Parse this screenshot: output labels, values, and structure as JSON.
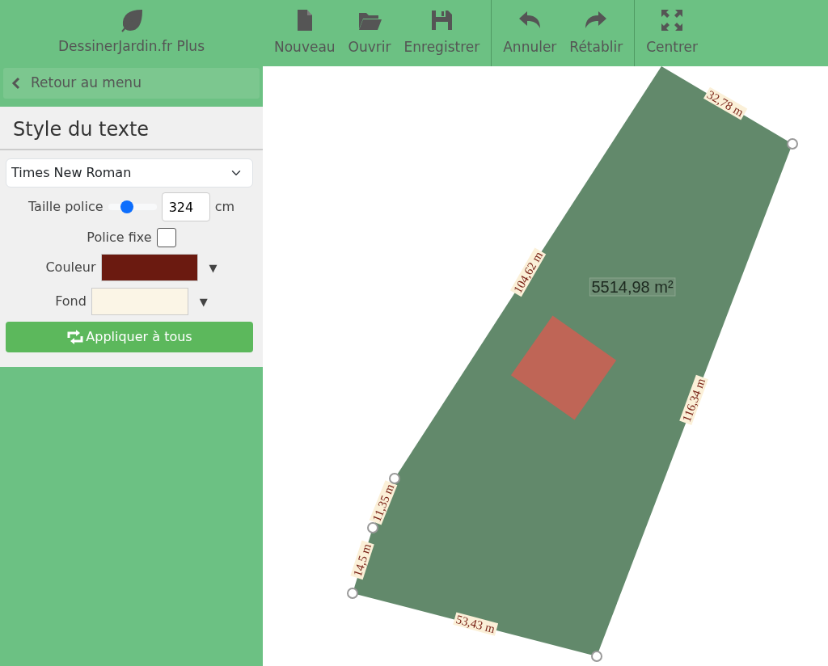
{
  "app": {
    "title": "DessinerJardin.fr Plus"
  },
  "toolbar": {
    "groups": [
      {
        "buttons": [
          {
            "label": "Nouveau",
            "kind": "file"
          },
          {
            "label": "Ouvrir",
            "kind": "folder"
          },
          {
            "label": "Enregistrer",
            "kind": "save"
          }
        ]
      },
      {
        "buttons": [
          {
            "label": "Annuler",
            "kind": "undo"
          },
          {
            "label": "Rétablir",
            "kind": "redo"
          }
        ]
      },
      {
        "buttons": [
          {
            "label": "Centrer",
            "kind": "center"
          }
        ]
      }
    ]
  },
  "sidebar": {
    "back_button": "Retour au menu",
    "panel_title": "Style du texte",
    "font": "Times New Roman",
    "font_size": {
      "label": "Taille police",
      "level": 0.35,
      "value": "324",
      "unit": "cm"
    },
    "fixed_font": {
      "label": "Police fixe",
      "checked": false
    },
    "colors": [
      {
        "label": "Couleur",
        "color": "#6b1a10",
        "arrow": "▼"
      },
      {
        "label": "Fond",
        "color": "#fbf5e6",
        "arrow": "▼"
      }
    ],
    "apply_button": "Appliquer à tous"
  },
  "canvas": {
    "area_label": "5514,98 m²",
    "edge_labels": [
      "32,78 m",
      "116,34 m",
      "53,43 m",
      "14,5 m",
      "11,35 m",
      "104,62 m"
    ]
  }
}
